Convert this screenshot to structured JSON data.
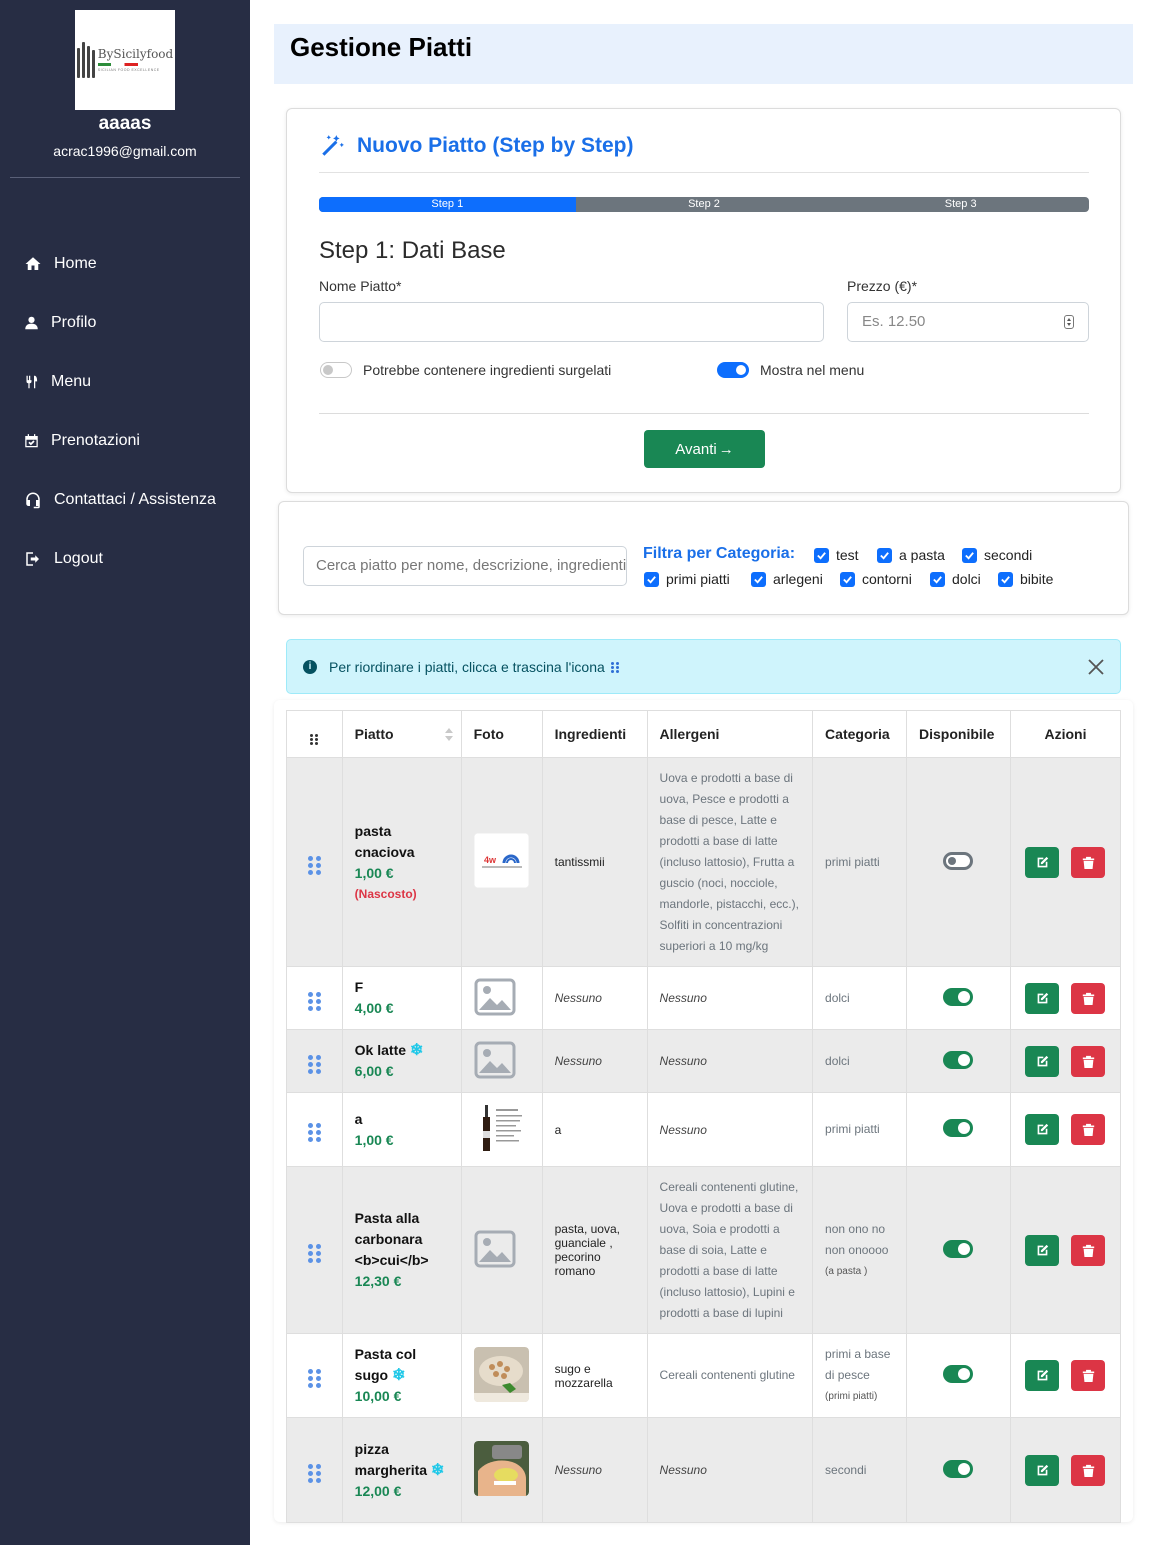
{
  "sidebar": {
    "logo_alt": "BySicilyfood",
    "logo_sub": "SICILIAN FOOD EXCELLENCE",
    "user_name": "aaaas",
    "user_email": "acrac1996@gmail.com",
    "items": [
      {
        "label": "Home",
        "icon": "home-icon"
      },
      {
        "label": "Profilo",
        "icon": "user-icon"
      },
      {
        "label": "Menu",
        "icon": "utensils-icon"
      },
      {
        "label": "Prenotazioni",
        "icon": "calendar-check-icon"
      },
      {
        "label": "Contattaci / Assistenza",
        "icon": "headset-icon"
      },
      {
        "label": "Logout",
        "icon": "logout-icon"
      }
    ]
  },
  "header": {
    "title": "Gestione Piatti"
  },
  "wizard": {
    "title": "Nuovo Piatto (Step by Step)",
    "steps": [
      "Step 1",
      "Step 2",
      "Step 3"
    ],
    "active_step": 1,
    "step_heading": "Step 1: Dati Base",
    "name_label": "Nome Piatto*",
    "name_value": "",
    "price_label": "Prezzo (€)*",
    "price_placeholder": "Es. 12.50",
    "frozen_label": "Potrebbe contenere ingredienti surgelati",
    "frozen_on": false,
    "show_menu_label": "Mostra nel menu",
    "show_menu_on": true,
    "next_label": "Avanti",
    "next_arrow": "→"
  },
  "filter": {
    "search_placeholder": "Cerca piatto per nome, descrizione, ingredienti",
    "label": "Filtra per Categoria:",
    "categories": [
      "test",
      "a pasta",
      "secondi",
      "primi piatti",
      "arlegeni",
      "contorni",
      "dolci",
      "bibite"
    ]
  },
  "alert": {
    "text": "Per riordinare i piatti, clicca e trascina l'icona"
  },
  "table": {
    "headers": [
      "Piatto",
      "Foto",
      "Ingredienti",
      "Allergeni",
      "Categoria",
      "Disponibile",
      "Azioni"
    ],
    "rows": [
      {
        "name": "pasta cnaciova",
        "price": "1,00 €",
        "hidden": "(Nascosto)",
        "frozen": false,
        "photo": "logo",
        "ingredients": "tantissmii",
        "allergens": "Uova e prodotti a base di uova, Pesce e prodotti a base di pesce, Latte e prodotti a base di latte (incluso lattosio), Frutta a guscio (noci, nocciole, mandorle, pistacchi, ecc.), Solfiti in concentrazioni superiori a 10 mg/kg",
        "category": "primi piatti",
        "category_sub": "",
        "available": false
      },
      {
        "name": "F",
        "price": "4,00 €",
        "hidden": "",
        "frozen": false,
        "photo": "placeholder",
        "ingredients": "Nessuno",
        "allergens": "Nessuno",
        "category": "dolci",
        "category_sub": "",
        "available": true
      },
      {
        "name": "Ok latte",
        "price": "6,00 €",
        "hidden": "",
        "frozen": true,
        "photo": "placeholder",
        "ingredients": "Nessuno",
        "allergens": "Nessuno",
        "category": "dolci",
        "category_sub": "",
        "available": true
      },
      {
        "name": "a",
        "price": "1,00 €",
        "hidden": "",
        "frozen": false,
        "photo": "wine",
        "ingredients": "a",
        "allergens": "Nessuno",
        "category": "primi piatti",
        "category_sub": "",
        "available": true
      },
      {
        "name": "Pasta alla carbonara <b>cui</b>",
        "price": "12,30 €",
        "hidden": "",
        "frozen": false,
        "photo": "placeholder",
        "ingredients": "pasta, uova, guanciale , pecorino romano",
        "allergens": "Cereali contenenti glutine, Uova e prodotti a base di uova, Soia e prodotti a base di soia, Latte e prodotti a base di latte (incluso lattosio), Lupini e prodotti a base di lupini",
        "category": "non ono no non onoooo",
        "category_sub": "(a pasta )",
        "available": true
      },
      {
        "name": "Pasta col sugo",
        "price": "10,00 €",
        "hidden": "",
        "frozen": true,
        "photo": "food",
        "ingredients": "sugo e mozzarella",
        "allergens": "Cereali contenenti glutine",
        "category": "primi a base di pesce",
        "category_sub": "(primi piatti)",
        "available": true
      },
      {
        "name": "pizza margherita",
        "price": "12,00 €",
        "hidden": "",
        "frozen": true,
        "photo": "hand",
        "ingredients": "Nessuno",
        "allergens": "Nessuno",
        "category": "secondi",
        "category_sub": "",
        "available": true
      }
    ]
  },
  "colors": {
    "sidebar": "#272d44",
    "accent": "#1a6fe8",
    "success": "#198754",
    "danger": "#dc3545"
  }
}
